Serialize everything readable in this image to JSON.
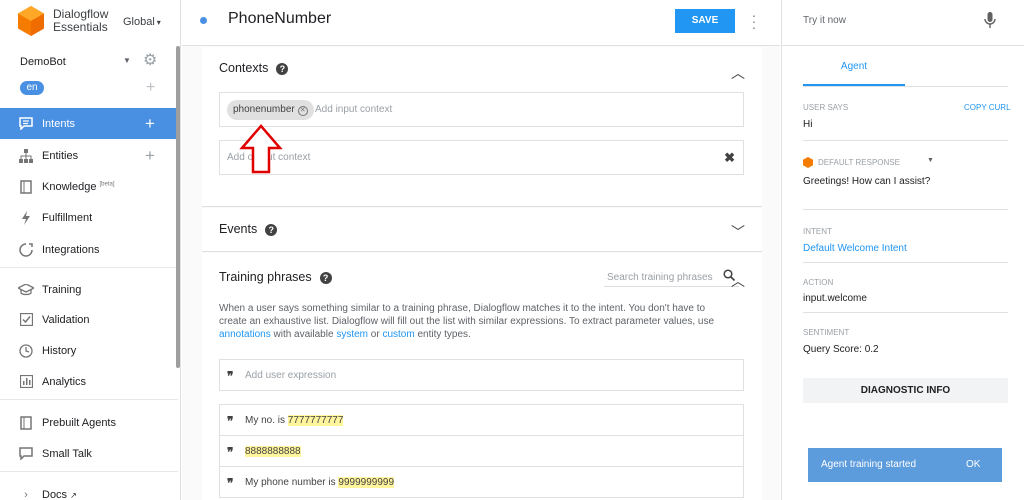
{
  "sidebar": {
    "brand_line1": "Dialogflow",
    "brand_line2": "Essentials",
    "region": "Global",
    "agent_name": "DemoBot",
    "language": "en",
    "items": [
      {
        "label": "Intents",
        "icon": "chat-bubble-icon",
        "plus": "+"
      },
      {
        "label": "Entities",
        "icon": "hierarchy-icon",
        "plus": "+"
      },
      {
        "label": "Knowledge",
        "beta": "[beta]",
        "icon": "book-icon"
      },
      {
        "label": "Fulfillment",
        "icon": "bolt-icon"
      },
      {
        "label": "Integrations",
        "icon": "integrations-icon"
      },
      {
        "label": "Training",
        "icon": "graduation-cap-icon"
      },
      {
        "label": "Validation",
        "icon": "checkbox-icon"
      },
      {
        "label": "History",
        "icon": "clock-icon"
      },
      {
        "label": "Analytics",
        "icon": "bar-chart-icon"
      },
      {
        "label": "Prebuilt Agents",
        "icon": "book-icon"
      },
      {
        "label": "Small Talk",
        "icon": "chat-icon"
      },
      {
        "label": "Docs",
        "icon": "chevron-right-icon"
      }
    ]
  },
  "header": {
    "intent_name": "PhoneNumber",
    "save_label": "SAVE"
  },
  "contexts": {
    "title": "Contexts",
    "input_chip": "phonenumber",
    "input_placeholder": "Add input context",
    "output_placeholder": "Add output context"
  },
  "events": {
    "title": "Events"
  },
  "training": {
    "title": "Training phrases",
    "search_placeholder": "Search training phrases",
    "desc_part1": "When a user says something similar to a training phrase, Dialogflow matches it to the intent. You don't have to create an exhaustive list. Dialogflow will fill out the list with similar expressions. To extract parameter values, use ",
    "desc_link1": "annotations",
    "desc_part2": " with available ",
    "desc_link2": "system",
    "desc_part3": " or ",
    "desc_link3": "custom",
    "desc_part4": " entity types.",
    "add_placeholder": "Add user expression",
    "phrases": [
      {
        "prefix": "My no. is ",
        "entity": "7777777777"
      },
      {
        "prefix": "",
        "entity": "8888888888"
      },
      {
        "prefix": "My phone number is ",
        "entity": "9999999999"
      }
    ]
  },
  "right_panel": {
    "try_placeholder": "Try it now",
    "tab_agent": "Agent",
    "user_says_label": "USER SAYS",
    "copy_curl": "COPY CURL",
    "user_says_value": "Hi",
    "default_response_label": "DEFAULT RESPONSE",
    "default_response_value": "Greetings! How can I assist?",
    "intent_label": "INTENT",
    "intent_value": "Default Welcome Intent",
    "action_label": "ACTION",
    "action_value": "input.welcome",
    "sentiment_label": "SENTIMENT",
    "sentiment_value": "Query Score: 0.2",
    "diagnostic_label": "DIAGNOSTIC INFO",
    "toast_message": "Agent training started",
    "toast_ok": "OK"
  },
  "colors": {
    "accent": "#4a90e2",
    "save": "#2196f3",
    "highlight": "#fff59d",
    "arrow": "#e00000",
    "logo": "#f57c00"
  }
}
